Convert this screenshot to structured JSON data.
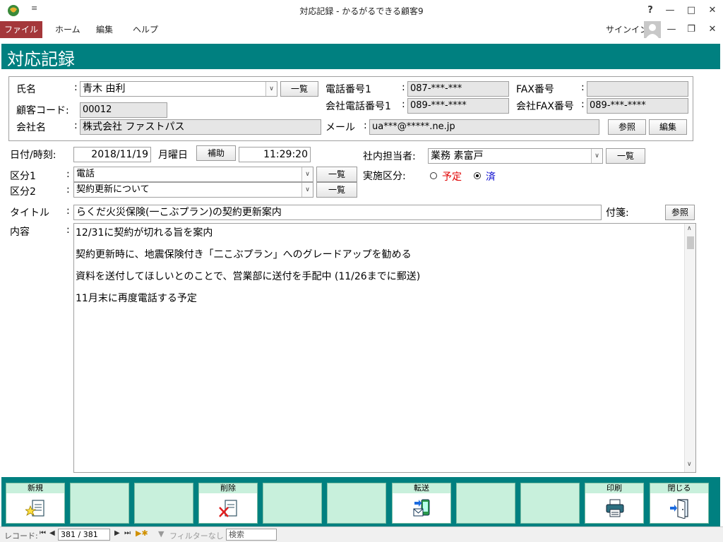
{
  "window": {
    "title": "対応記録 - かるがるできる顧客9",
    "help": "?",
    "signin": "サインイン"
  },
  "menu": {
    "file": "ファイル",
    "home": "ホーム",
    "edit": "編集",
    "help": "ヘルプ"
  },
  "form": {
    "heading": "対応記録",
    "name_label": "氏名",
    "name_value": "青木 由利",
    "customer_code_label": "顧客コード:",
    "customer_code_value": "00012",
    "company_label": "会社名",
    "company_value": "株式会社 ファストパス",
    "phone1_label": "電話番号1",
    "phone1_value": "087-***-***",
    "company_phone1_label": "会社電話番号1",
    "company_phone1_value": "089-***-****",
    "mail_label": "メール",
    "mail_value": "ua***@*****.ne.jp",
    "fax_label": "FAX番号",
    "fax_value": "",
    "company_fax_label": "会社FAX番号",
    "company_fax_value": "089-***-****",
    "list_button": "一覧",
    "browse_button": "参照",
    "edit_button": "編集",
    "date_label": "日付/時刻:",
    "date_value": "2018/11/19",
    "weekday": "月曜日",
    "assist_button": "補助",
    "time_value": "11:29:20",
    "staff_label": "社内担当者:",
    "staff_value": "業務 素富戸",
    "category1_label": "区分1",
    "category1_value": "電話",
    "category2_label": "区分2",
    "category2_value": "契約更新について",
    "status_label": "実施区分:",
    "status_planned": "予定",
    "status_done": "済",
    "title_label": "タイトル",
    "title_value": "らくだ火災保険(一こぶプラン)の契約更新案内",
    "tag_label": "付箋:",
    "content_label": "内容",
    "colon": ":",
    "content_lines": [
      "12/31に契約が切れる旨を案内",
      "契約更新時に、地震保険付き「二こぶプラン」へのグレードアップを勧める",
      "資料を送付してほしいとのことで、営業部に送付を手配中 (11/26までに郵送)",
      "11月末に再度電話する予定"
    ]
  },
  "toolbar": {
    "new": "新規",
    "delete": "削除",
    "transfer": "転送",
    "print": "印刷",
    "close": "閉じる"
  },
  "status": {
    "record_label": "レコード:",
    "record_value": "381 / 381",
    "filter": "フィルターなし",
    "search": "検索"
  },
  "colors": {
    "teal": "#008080",
    "accent_red": "#a4373a",
    "mint": "#c8f0dc"
  }
}
